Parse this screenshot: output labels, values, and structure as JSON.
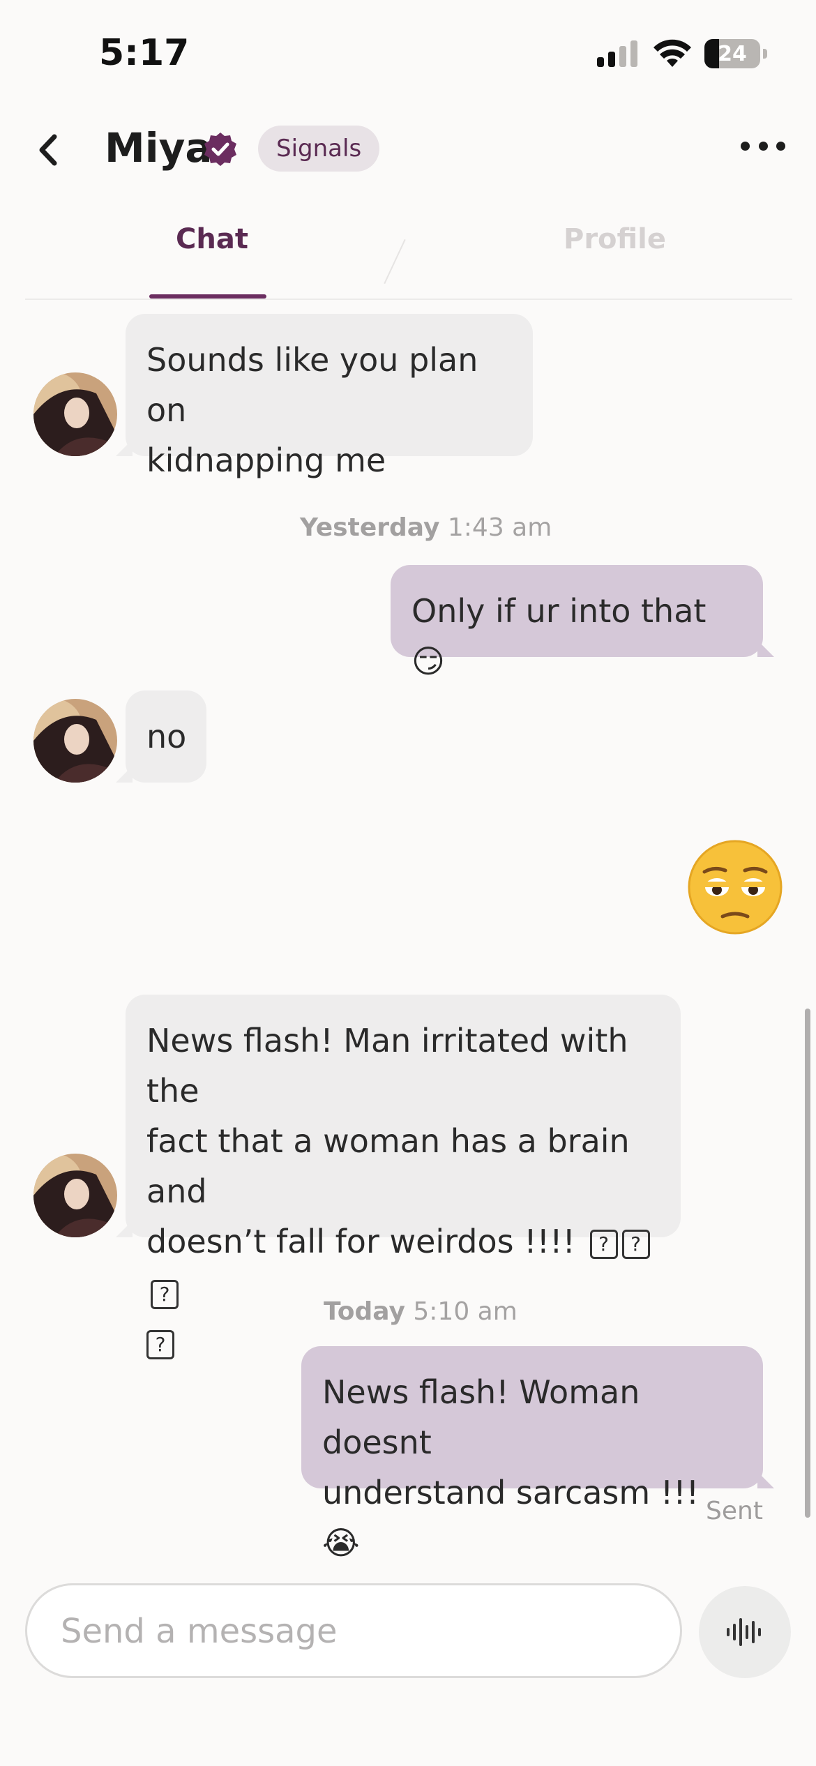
{
  "status_bar": {
    "time": "5:17",
    "battery": "24"
  },
  "header": {
    "name": "Miya",
    "badge": "Signals"
  },
  "tabs": [
    {
      "label": "Chat"
    },
    {
      "label": "Profile"
    }
  ],
  "messages": [
    {
      "from": "them",
      "text_lines": [
        "Sounds like you plan on",
        "kidnapping me"
      ]
    },
    {
      "timestamp_day": "Yesterday",
      "timestamp_time": "1:43 am"
    },
    {
      "from": "me",
      "text": "Only if ur into that 😏"
    },
    {
      "from": "them",
      "text": "no"
    },
    {
      "from": "me",
      "emoji": "😩"
    },
    {
      "from": "them",
      "text_lines": [
        "News flash! Man irritated with the",
        "fact that a woman has a brain and",
        "doesn’t fall for weirdos !!!!"
      ]
    },
    {
      "timestamp_day": "Today",
      "timestamp_time": "5:10 am"
    },
    {
      "from": "me",
      "text_lines": [
        "News flash! Woman doesnt",
        "understand sarcasm !!! 😭"
      ]
    }
  ],
  "sent_status": "Sent",
  "composer": {
    "placeholder": "Send a message"
  },
  "colors": {
    "accent": "#6b2d60",
    "bubble_out": "#d5c8d8",
    "bubble_in": "#eeeded"
  }
}
